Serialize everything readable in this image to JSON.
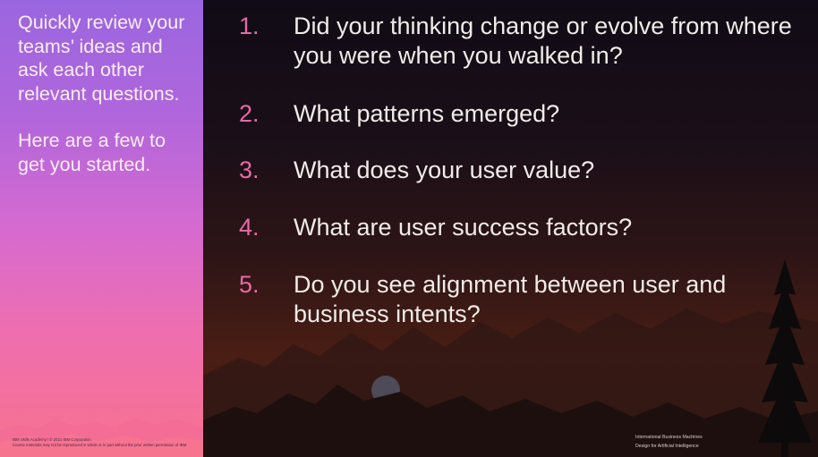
{
  "intro": {
    "line1": "Quickly review your teams’ ideas and ask each other relevant questions.",
    "line2": "Here are a few to get you started."
  },
  "questions": [
    {
      "num": "1.",
      "text": "Did your thinking change or evolve from where you were when you walked in?"
    },
    {
      "num": "2.",
      "text": "What patterns emerged?"
    },
    {
      "num": "3.",
      "text": "What does your user value?"
    },
    {
      "num": "4.",
      "text": "What are user success factors?"
    },
    {
      "num": "5.",
      "text": "Do you see alignment between user and business intents?"
    }
  ],
  "footer_left": {
    "line1": "IBM Skills Academy / © 2021 IBM Corporation",
    "line2": "Course materials may not be reproduced in whole or in part without the prior written permission of IBM."
  },
  "footer_right": {
    "line1": "International Business Machines",
    "line2": "Design for Artificial Intelligence"
  },
  "colors": {
    "accent_number": "#e66aa6",
    "question_text": "#f0ece8",
    "left_gradient_top": "#9a66e0",
    "left_gradient_bottom": "#f8728e"
  }
}
